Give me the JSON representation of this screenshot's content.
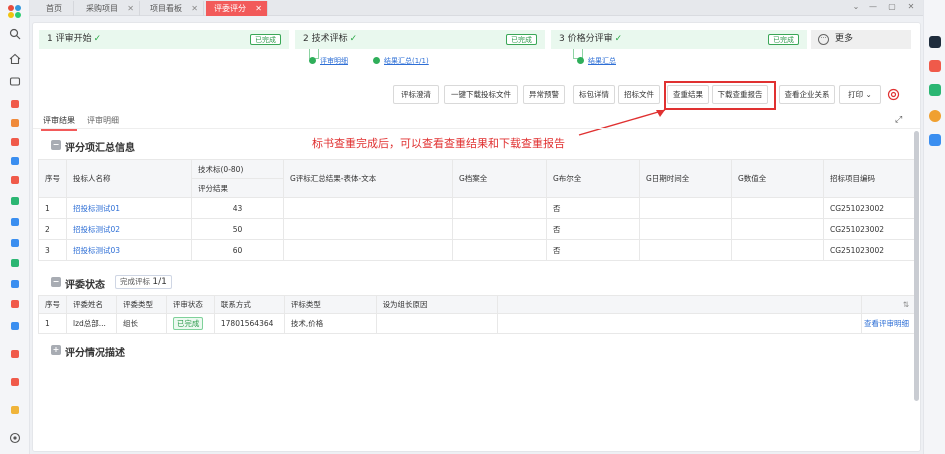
{
  "tabs": [
    {
      "label": "首页"
    },
    {
      "label": "采购项目"
    },
    {
      "label": "项目看板"
    },
    {
      "label": "评委评分"
    }
  ],
  "steps": [
    {
      "label": "1 评审开始",
      "badge": "已完成"
    },
    {
      "label": "2 技术评标",
      "badge": "已完成"
    },
    {
      "label": "3 价格分评审",
      "badge": "已完成"
    },
    {
      "label": "更多"
    }
  ],
  "sub_links": {
    "review_detail": "评审明细",
    "result_summary": "结果汇总(1/1)",
    "result_summary2": "结果汇总"
  },
  "toolbar": {
    "clarify": "评标澄清",
    "download_files": "一键下载投标文件",
    "warning": "异常预警",
    "package_detail": "标包详情",
    "bid_file": "招标文件",
    "check_result": "查重结果",
    "download_report": "下载查重报告",
    "company_relation": "查看企业关系",
    "print": "打印"
  },
  "annotation": "标书查重完成后，可以查看查重结果和下载查重报告",
  "result_tabs": [
    "评审结果",
    "评审明细"
  ],
  "score_section": {
    "title": "评分项汇总信息",
    "headers": {
      "seq": "序号",
      "bidder": "投标人名称",
      "tech": "技术标(0-80)",
      "tech_sub": "评分结果",
      "g1": "G评标汇总结果-表体-文本",
      "g2": "G档案全",
      "g3": "G布尔全",
      "g4": "G日期时间全",
      "g5": "G数值全",
      "code": "招标项目编码"
    },
    "rows": [
      {
        "seq": "1",
        "bidder": "招投标测试01",
        "score": "43",
        "bool": "否",
        "code": "CG251023002"
      },
      {
        "seq": "2",
        "bidder": "招投标测试02",
        "score": "50",
        "bool": "否",
        "code": "CG251023002"
      },
      {
        "seq": "3",
        "bidder": "招投标测试03",
        "score": "60",
        "bool": "否",
        "code": "CG251023002"
      }
    ]
  },
  "judge_section": {
    "title": "评委状态",
    "progress_label": "完成评标",
    "progress_value": "1/1",
    "headers": {
      "seq": "序号",
      "name": "评委姓名",
      "type": "评委类型",
      "status": "评审状态",
      "contact": "联系方式",
      "review_type": "评标类型",
      "reason": "设为组长原因"
    },
    "rows": [
      {
        "seq": "1",
        "name": "lzd总部...",
        "type": "组长",
        "status": "已完成",
        "contact": "17801564364",
        "review_type": "技术,价格",
        "action": "查看评审明细"
      }
    ]
  },
  "desc_section": {
    "title": "评分情况描述"
  },
  "colors": {
    "accent": "#f25a5a",
    "success": "#2e9b4d",
    "link": "#2e6fd6",
    "annotation": "#e03131"
  }
}
